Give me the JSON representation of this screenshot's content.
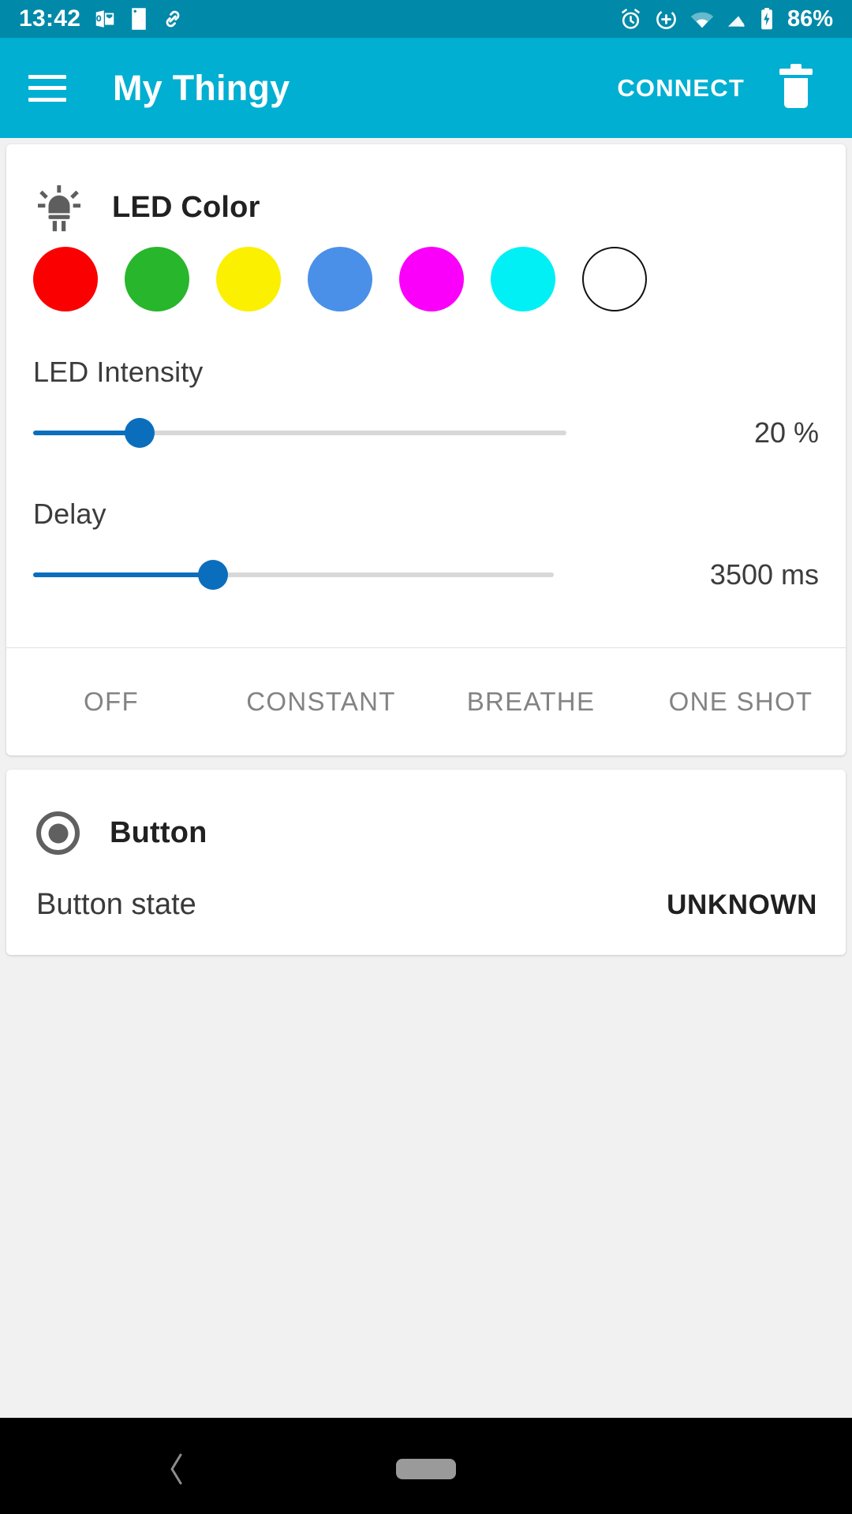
{
  "status_bar": {
    "time": "13:42",
    "battery_percent": "86%",
    "left_icons": [
      "outlook-icon",
      "sim-card-icon",
      "link-icon"
    ],
    "right_icons": [
      "alarm-icon",
      "do-not-disturb-icon",
      "wifi-icon",
      "signal-off-icon",
      "battery-charging-icon"
    ],
    "background_color": "#0089a8"
  },
  "app_bar": {
    "menu_icon": "hamburger-menu-icon",
    "title": "My Thingy",
    "connect_label": "CONNECT",
    "delete_icon": "trash-icon",
    "background_color": "#00AFD1"
  },
  "led_card": {
    "icon": "led-bulb-icon",
    "title": "LED Color",
    "colors": [
      {
        "name": "red",
        "hex": "#FA0000"
      },
      {
        "name": "green",
        "hex": "#28B62C"
      },
      {
        "name": "yellow",
        "hex": "#FAF000"
      },
      {
        "name": "blue",
        "hex": "#4A90E8"
      },
      {
        "name": "magenta",
        "hex": "#FA00FA"
      },
      {
        "name": "cyan",
        "hex": "#00F0F5"
      },
      {
        "name": "white",
        "hex": "#FFFFFF"
      }
    ],
    "intensity": {
      "label": "LED Intensity",
      "value": "20 %",
      "percent": 20
    },
    "delay": {
      "label": "Delay",
      "value": "3500 ms",
      "percent": 34.5
    },
    "modes": [
      {
        "label": "OFF",
        "selected": false
      },
      {
        "label": "CONSTANT",
        "selected": false
      },
      {
        "label": "BREATHE",
        "selected": false
      },
      {
        "label": "ONE SHOT",
        "selected": false
      }
    ],
    "accent_color": "#0b6ebd"
  },
  "button_card": {
    "icon": "radio-button-icon",
    "title": "Button",
    "state_label": "Button state",
    "state_value": "UNKNOWN"
  },
  "nav_bar": {
    "back_icon": "back-chevron-icon",
    "home_icon": "home-pill-icon"
  }
}
